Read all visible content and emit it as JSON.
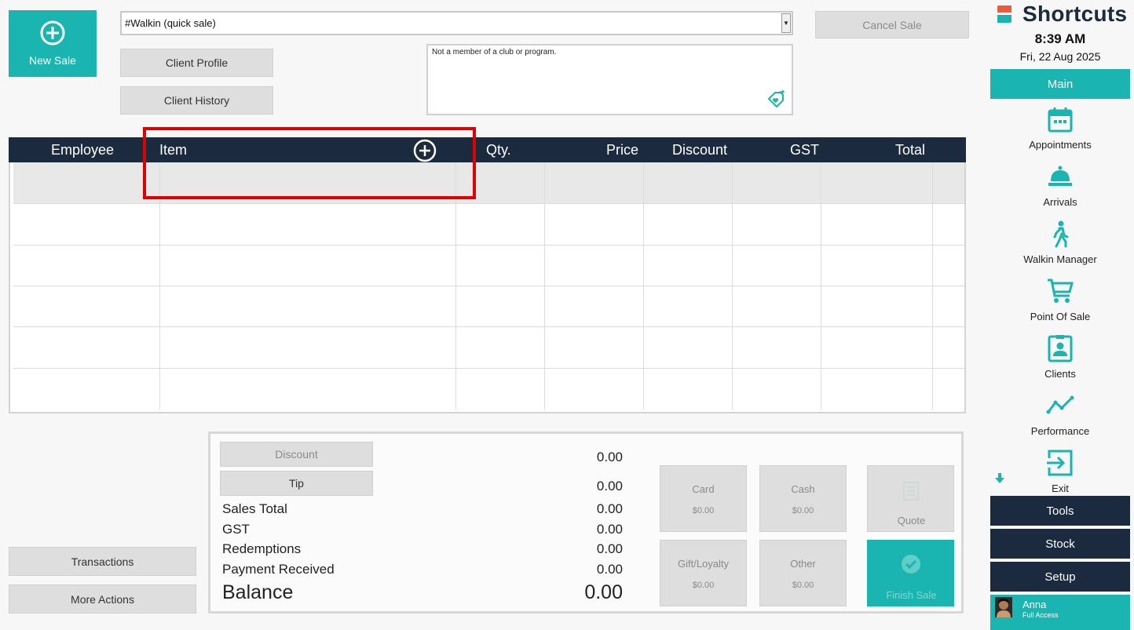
{
  "new_sale": {
    "label": "New Sale"
  },
  "client": {
    "selected": "#Walkin (quick sale)",
    "profile_label": "Client Profile",
    "history_label": "Client History"
  },
  "cancel_sale_label": "Cancel Sale",
  "club_info": "Not a member of a club or program.",
  "grid": {
    "columns": [
      "Employee",
      "Item",
      "Qty.",
      "Price",
      "Discount",
      "GST",
      "Total"
    ]
  },
  "left_actions": {
    "transactions": "Transactions",
    "more_actions": "More Actions"
  },
  "totals": {
    "discount_label": "Discount",
    "tip_label": "Tip",
    "discount_value": "0.00",
    "tip_value": "0.00",
    "rows": [
      {
        "label": "Sales Total",
        "value": "0.00"
      },
      {
        "label": "GST",
        "value": "0.00"
      },
      {
        "label": "Redemptions",
        "value": "0.00"
      },
      {
        "label": "Payment Received",
        "value": "0.00"
      }
    ],
    "balance_label": "Balance",
    "balance_value": "0.00"
  },
  "payments": {
    "card": {
      "label": "Card",
      "amount": "$0.00"
    },
    "cash": {
      "label": "Cash",
      "amount": "$0.00"
    },
    "quote": {
      "label": "Quote"
    },
    "gift": {
      "label": "Gift/Loyalty",
      "amount": "$0.00"
    },
    "other": {
      "label": "Other",
      "amount": "$0.00"
    },
    "finish": {
      "label": "Finish Sale"
    }
  },
  "sidebar": {
    "title": "Shortcuts",
    "time": "8:39 AM",
    "date": "Fri, 22 Aug 2025",
    "main_tab": "Main",
    "items": [
      {
        "label": "Appointments",
        "icon": "calendar-icon"
      },
      {
        "label": "Arrivals",
        "icon": "bell-icon"
      },
      {
        "label": "Walkin Manager",
        "icon": "walking-person-icon"
      },
      {
        "label": "Point Of Sale",
        "icon": "cart-icon"
      },
      {
        "label": "Clients",
        "icon": "client-card-icon"
      },
      {
        "label": "Performance",
        "icon": "trend-line-icon"
      },
      {
        "label": "Exit",
        "icon": "exit-icon"
      }
    ],
    "tools": "Tools",
    "stock": "Stock",
    "setup": "Setup",
    "user_name": "Anna",
    "user_role": "Full Access"
  },
  "colors": {
    "teal": "#1ab5b0",
    "navy": "#1b2a3e",
    "highlight": "#e00000"
  }
}
